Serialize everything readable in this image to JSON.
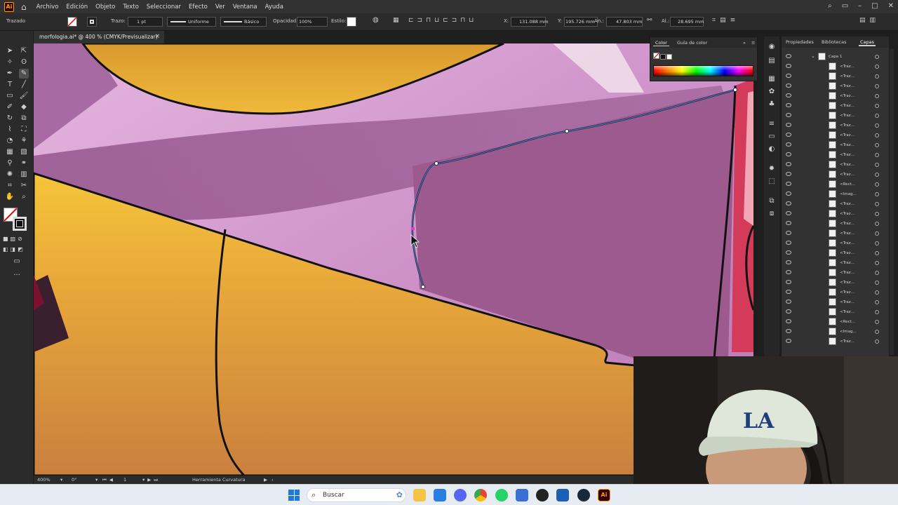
{
  "app": {
    "logo": "Ai",
    "brand_color": "#ff9a00"
  },
  "menubar": {
    "items": [
      "Archivo",
      "Edición",
      "Objeto",
      "Texto",
      "Seleccionar",
      "Efecto",
      "Ver",
      "Ventana",
      "Ayuda"
    ],
    "right_icons": [
      "search-icon",
      "workspace-icon",
      "minimize-icon",
      "maximize-icon",
      "close-icon"
    ]
  },
  "controlbar": {
    "selection_label": "Trazado",
    "stroke_label": "Trazo:",
    "stroke_weight": "1 pt",
    "stroke_profile": "Uniforme",
    "brush": "Básico",
    "opacity_label": "Opacidad:",
    "opacity_value": "100%",
    "style_label": "Estilo:",
    "x_label": "X:",
    "x_value": "131.088 mm",
    "y_label": "Y:",
    "y_value": "195.726 mm",
    "w_label": "An.:",
    "w_value": "47.803 mm",
    "h_label": "Al.:",
    "h_value": "28.695 mm"
  },
  "document": {
    "tab_title": "morfologia.ai* @ 400 % (CMYK/Previsualizar)",
    "close_glyph": "×"
  },
  "statusbar": {
    "zoom": "400%",
    "rotation": "0°",
    "artboard": "1",
    "tool": "Herramienta Curvatura"
  },
  "color_panel": {
    "tabs": [
      "Color",
      "Guía de color"
    ],
    "active_tab": "Color"
  },
  "layers_panel": {
    "tabs": [
      "Propiedades",
      "Bibliotecas",
      "Capas"
    ],
    "active_tab": "Capas",
    "layer_name": "Capa 1",
    "rows": [
      "<Traz...",
      "<Traz...",
      "<Traz...",
      "<Traz...",
      "<Traz...",
      "<Traz...",
      "<Traz...",
      "<Traz...",
      "<Traz...",
      "<Traz...",
      "<Traz...",
      "<Traz...",
      "<Rect...",
      "<Imag...",
      "<Traz...",
      "<Traz...",
      "<Traz...",
      "<Traz...",
      "<Traz...",
      "<Traz...",
      "<Traz...",
      "<Traz...",
      "<Traz...",
      "<Traz...",
      "<Traz...",
      "<Traz...",
      "<Rect...",
      "<Imag...",
      "<Traz..."
    ]
  },
  "taskbar": {
    "search_placeholder": "Buscar",
    "icons": [
      "windows-start-icon",
      "search-icon",
      "file-explorer-icon",
      "notepad-icon",
      "discord-icon",
      "chrome-icon",
      "whatsapp-icon",
      "app-icon",
      "github-icon",
      "store-icon",
      "steam-icon",
      "illustrator-icon"
    ]
  },
  "webcam": {
    "cap_logo": "LA"
  }
}
